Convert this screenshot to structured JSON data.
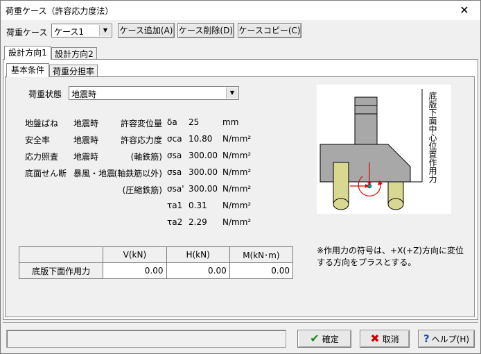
{
  "window": {
    "title": "荷重ケース（許容応力度法）",
    "close": "✕"
  },
  "toolbar": {
    "case_label": "荷重ケース",
    "case_value": "ケース1",
    "add_button": "ケース追加(A)",
    "delete_button": "ケース削除(D)",
    "copy_button": "ケースコピー(C)"
  },
  "tabs": [
    "設計方向1",
    "設計方向2"
  ],
  "subtabs": [
    "基本条件",
    "荷重分担率"
  ],
  "load_state": {
    "label": "荷重状態",
    "value": "地震時"
  },
  "params": [
    {
      "c1": "地盤ばね",
      "c2": "地震時",
      "name": "許容変位量",
      "sym": "δa",
      "value": "25",
      "unit": "mm"
    },
    {
      "c1": "安全率",
      "c2": "地震時",
      "name": "許容応力度",
      "sym": "σca",
      "value": "10.80",
      "unit": "N/mm²"
    },
    {
      "c1": "応力照査",
      "c2": "地震時",
      "name": "(軸鉄筋)",
      "sym": "σsa",
      "value": "300.00",
      "unit": "N/mm²"
    },
    {
      "c1": "底面せん断",
      "c2": "暴風・地震",
      "name": "(軸鉄筋以外)",
      "sym": "σsa",
      "value": "300.00",
      "unit": "N/mm²"
    },
    {
      "c1": "",
      "c2": "",
      "name": "(圧縮鉄筋)",
      "sym": "σsa'",
      "value": "300.00",
      "unit": "N/mm²"
    },
    {
      "c1": "",
      "c2": "",
      "name": "",
      "sym": "τa1",
      "value": "0.31",
      "unit": "N/mm²"
    },
    {
      "c1": "",
      "c2": "",
      "name": "",
      "sym": "τa2",
      "value": "2.29",
      "unit": "N/mm²"
    }
  ],
  "diagram": {
    "vertical_label": "底版下面中心位置作用力"
  },
  "note": {
    "line1": "※作用力の符号は、+X(+Z)方向に変位",
    "line2": "する方向をプラスとする。"
  },
  "force_table": {
    "headers": [
      "V(kN)",
      "H(kN)",
      "M(kN･m)"
    ],
    "row_label": "底版下面作用力",
    "values": [
      "0.00",
      "0.00",
      "0.00"
    ]
  },
  "footer": {
    "ok": "確定",
    "cancel": "取消",
    "help": "ヘルプ(H)"
  },
  "colors": {
    "pile": "#d8d890",
    "footing": "#a8a8a8",
    "accent_red": "#e00000"
  }
}
